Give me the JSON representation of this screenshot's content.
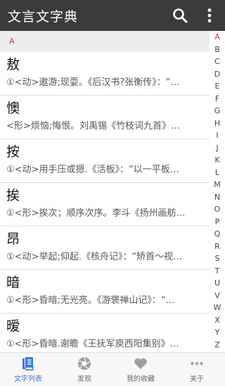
{
  "app": {
    "title": "文言文字典"
  },
  "section_header": "A",
  "entries": [
    {
      "head": "敖",
      "def": "①<动>遨游;现耍。《后汉书?张衡传》：“…"
    },
    {
      "head": "懊",
      "def": "<形>烦恼;悔恨。刘禹锡《竹枝词九首》…"
    },
    {
      "head": "按",
      "def": "①<动>用手压或摁.《活板》：“以一平板…"
    },
    {
      "head": "挨",
      "def": "①<形>挨次；顺序次序。李斗《扬州画舫…"
    },
    {
      "head": "昂",
      "def": "①<动>举起;仰起.《核舟记》：“矫首～视…"
    },
    {
      "head": "暗",
      "def": "①<形>昏暗;无光亮。《游褒禅山记》：“…"
    },
    {
      "head": "暧",
      "def": "①<形>昏暗.谢瞻《王抚军庾西阳集别》…"
    }
  ],
  "index_letters": [
    "A",
    "B",
    "C",
    "D",
    "E",
    "F",
    "G",
    "H",
    "I",
    "J",
    "K",
    "L",
    "M",
    "N",
    "O",
    "P",
    "Q",
    "R",
    "S",
    "T",
    "U",
    "V",
    "W",
    "X",
    "Y",
    "Z"
  ],
  "tabs": [
    {
      "label": "文字列表",
      "icon": "book-icon"
    },
    {
      "label": "发现",
      "icon": "aperture-icon"
    },
    {
      "label": "我的收藏",
      "icon": "heart-icon"
    },
    {
      "label": "关于",
      "icon": "more-dots-icon"
    }
  ],
  "colors": {
    "appbar": "#3b3b3b",
    "accent_red": "#e53935",
    "active_tab": "#3a78d6",
    "inactive_tab": "#9e9e9e"
  }
}
